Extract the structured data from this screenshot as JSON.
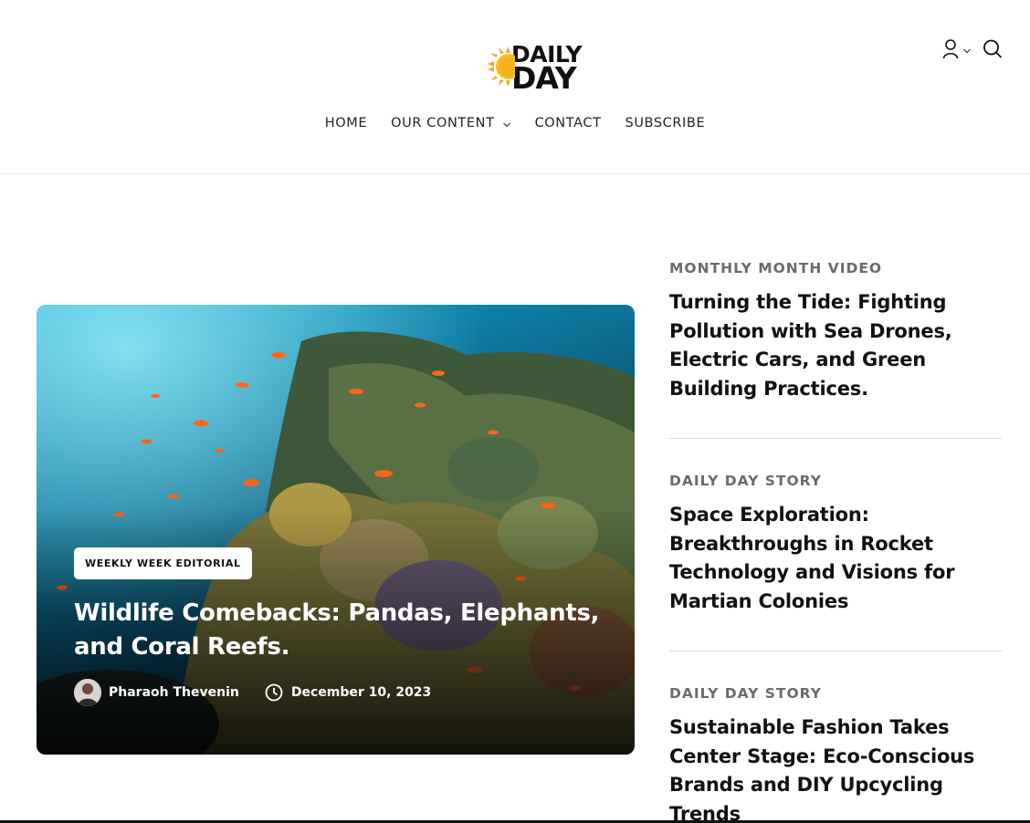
{
  "brand": {
    "name_line1": "DAILY",
    "name_line2": "DAY",
    "colors": {
      "sun_outer": "#f5a623",
      "sun_inner": "#f7c11a",
      "text": "#111111"
    }
  },
  "nav": {
    "items": [
      {
        "label": "HOME"
      },
      {
        "label": "OUR CONTENT",
        "has_dropdown": true
      },
      {
        "label": "CONTACT"
      },
      {
        "label": "SUBSCRIBE"
      }
    ]
  },
  "header_tools": {
    "account_icon": "user-icon",
    "account_dropdown_icon": "chevron-down-icon",
    "search_icon": "search-icon"
  },
  "featured": {
    "badge": "WEEKLY WEEK EDITORIAL",
    "title": "Wildlife Comebacks: Pandas, Elephants, and Coral Reefs.",
    "author": "Pharaoh Thevenin",
    "date": "December 10, 2023",
    "date_icon": "clock-icon"
  },
  "stories": [
    {
      "category": "MONTHLY MONTH VIDEO",
      "title": "Turning the Tide: Fighting Pollution with Sea Drones, Electric Cars, and Green Building Practices."
    },
    {
      "category": "DAILY DAY STORY",
      "title": "Space Exploration: Breakthroughs in Rocket Technology and Visions for Martian Colonies"
    },
    {
      "category": "DAILY DAY STORY",
      "title": "Sustainable Fashion Takes Center Stage: Eco-Conscious Brands and DIY Upcycling Trends"
    }
  ]
}
